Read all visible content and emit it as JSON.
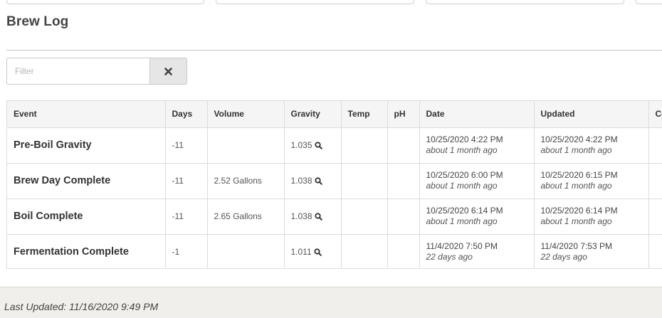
{
  "page": {
    "title": "Brew Log"
  },
  "filter": {
    "placeholder": "Filter",
    "value": "",
    "clear_icon": "close-icon"
  },
  "table": {
    "columns": [
      "Event",
      "Days",
      "Volume",
      "Gravity",
      "Temp",
      "pH",
      "Date",
      "Updated",
      "Co"
    ],
    "rows": [
      {
        "event": "Pre-Boil Gravity",
        "days": "-11",
        "volume": "",
        "gravity": "1.035",
        "temp": "",
        "ph": "",
        "date": "10/25/2020 4:22 PM",
        "date_ago": "about 1 month ago",
        "updated": "10/25/2020 4:22 PM",
        "updated_ago": "about 1 month ago",
        "comments": ""
      },
      {
        "event": "Brew Day Complete",
        "days": "-11",
        "volume": "2.52 Gallons",
        "gravity": "1.038",
        "temp": "",
        "ph": "",
        "date": "10/25/2020 6:00 PM",
        "date_ago": "about 1 month ago",
        "updated": "10/25/2020 6:15 PM",
        "updated_ago": "about 1 month ago",
        "comments": ""
      },
      {
        "event": "Boil Complete",
        "days": "-11",
        "volume": "2.65 Gallons",
        "gravity": "1.038",
        "temp": "",
        "ph": "",
        "date": "10/25/2020 6:14 PM",
        "date_ago": "about 1 month ago",
        "updated": "10/25/2020 6:14 PM",
        "updated_ago": "about 1 month ago",
        "comments": ""
      },
      {
        "event": "Fermentation Complete",
        "days": "-1",
        "volume": "",
        "gravity": "1.011",
        "temp": "",
        "ph": "",
        "date": "11/4/2020 7:50 PM",
        "date_ago": "22 days ago",
        "updated": "11/4/2020 7:53 PM",
        "updated_ago": "22 days ago",
        "comments": ""
      }
    ],
    "gravity_icon": "search-icon"
  },
  "footer": {
    "last_updated": "Last Updated: 11/16/2020 9:49 PM"
  },
  "colors": {
    "header_bg": "#f5f5f5",
    "footer_bg": "#f1efeb",
    "border": "#dcdcdc",
    "button_bg": "#e6e6e6"
  }
}
